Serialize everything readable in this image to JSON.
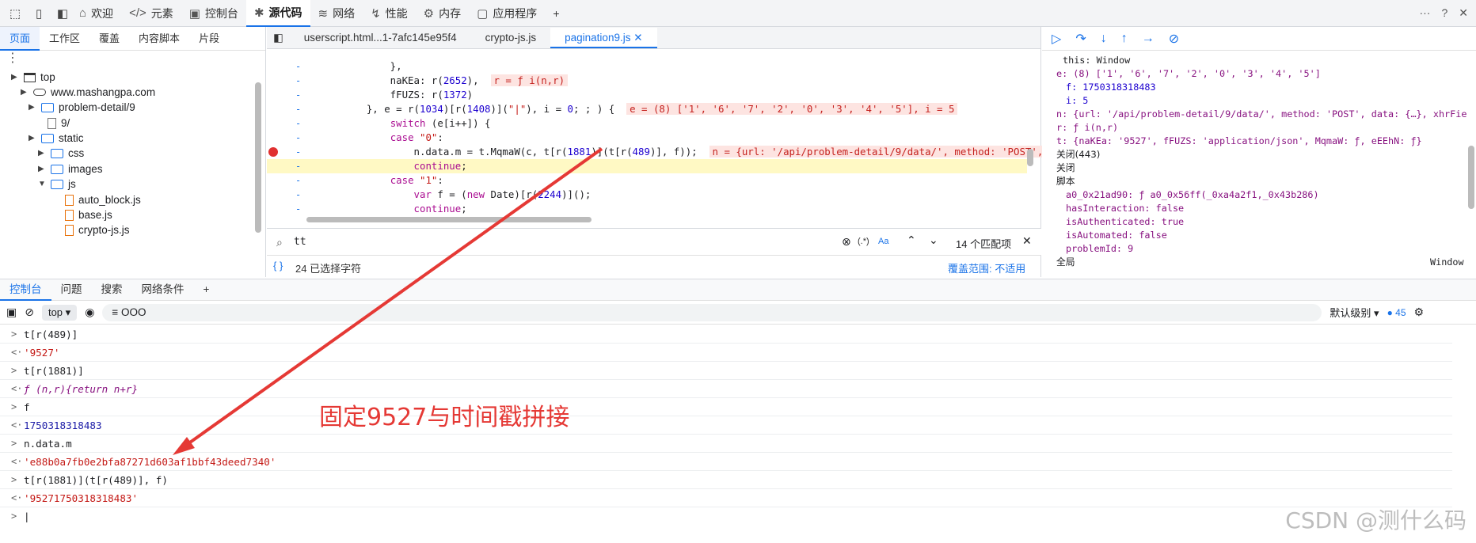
{
  "toolbar": {
    "tabs": [
      {
        "label": "欢迎",
        "icon": "home-icon"
      },
      {
        "label": "元素",
        "icon": "code-brackets-icon"
      },
      {
        "label": "控制台",
        "icon": "console-icon"
      },
      {
        "label": "源代码",
        "icon": "bug-icon"
      },
      {
        "label": "网络",
        "icon": "wifi-icon"
      },
      {
        "label": "性能",
        "icon": "performance-icon"
      },
      {
        "label": "内存",
        "icon": "memory-icon"
      },
      {
        "label": "应用程序",
        "icon": "application-icon"
      }
    ],
    "plus": "+",
    "right_icons": [
      "···",
      "?",
      "✕"
    ]
  },
  "left_panel": {
    "tabs": [
      "页面",
      "工作区",
      "覆盖",
      "内容脚本",
      "片段"
    ],
    "tree": [
      {
        "label": "top",
        "depth": 0
      },
      {
        "label": "www.mashangpa.com",
        "depth": 1
      },
      {
        "label": "problem-detail/9",
        "depth": 2
      },
      {
        "label": "9/",
        "depth": 3
      },
      {
        "label": "static",
        "depth": 2
      },
      {
        "label": "css",
        "depth": 3
      },
      {
        "label": "images",
        "depth": 3
      },
      {
        "label": "js",
        "depth": 3
      },
      {
        "label": "auto_block.js",
        "depth": 4
      },
      {
        "label": "base.js",
        "depth": 4
      },
      {
        "label": "crypto-js.js",
        "depth": 4
      }
    ]
  },
  "editor": {
    "tabs": [
      "userscript.html...1-7afc145e95f4",
      "crypto-js.js",
      "pagination9.js"
    ],
    "search_value": "tt",
    "search_regex": "(.*)",
    "search_case": "Aa",
    "match_count": "14 个匹配项",
    "status_left": "24 已选择字符",
    "status_right": "覆盖范围: 不适用"
  },
  "scope": {
    "lines": [
      "this: Window",
      "e: (8) ['1', '6', '7', '2', '0', '3', '4', '5']",
      "f: 1750318318483",
      "i: 5",
      "n: {url: '/api/problem-detail/9/data/', method: 'POST', data: {…}, xhrFie",
      "r: ƒ i(n,r)",
      "t: {naKEa: '9527', fFUZS: 'application/json', MqmaW: ƒ, eEEhN: ƒ}",
      "关闭(443)",
      "关闭",
      "脚本",
      "a0_0x21ad90: ƒ a0_0x56ff(_0xa4a2f1,_0x43b286)",
      "hasInteraction: false",
      "isAuthenticated: true",
      "isAutomated: false",
      "problemId: 9",
      "全局"
    ],
    "global_value": "Window"
  },
  "console": {
    "tabs": [
      "控制台",
      "问题",
      "搜索",
      "网络条件"
    ],
    "context": "top",
    "filter": "OOO",
    "level": "默认级别",
    "badge": "45",
    "entries": [
      {
        "prefix": ">",
        "text": "t[r(489)]",
        "kind": "in"
      },
      {
        "prefix": "<·",
        "text": "'9527'",
        "kind": "str"
      },
      {
        "prefix": ">",
        "text": "t[r(1881)]",
        "kind": "in"
      },
      {
        "prefix": "<·",
        "text": "ƒ (n,r){return n+r}",
        "kind": "fn"
      },
      {
        "prefix": ">",
        "text": "f",
        "kind": "in"
      },
      {
        "prefix": "<·",
        "text": "1750318318483",
        "kind": "num"
      },
      {
        "prefix": ">",
        "text": "n.data.m",
        "kind": "in"
      },
      {
        "prefix": "<·",
        "text": "'e88b0a7fb0e2bfa87271d603af1bbf43deed7340'",
        "kind": "str"
      },
      {
        "prefix": ">",
        "text": "t[r(1881)](t[r(489)], f)",
        "kind": "in"
      },
      {
        "prefix": "<·",
        "text": "'95271750318318483'",
        "kind": "str"
      },
      {
        "prefix": ">",
        "text": "|",
        "kind": "in"
      }
    ]
  },
  "annotation": "固定9527与时间戳拼接",
  "watermark": "CSDN @测什么码",
  "colors": {
    "accent": "#1a73e8",
    "annotation": "#e53935",
    "breakpoint": "#e03030"
  }
}
